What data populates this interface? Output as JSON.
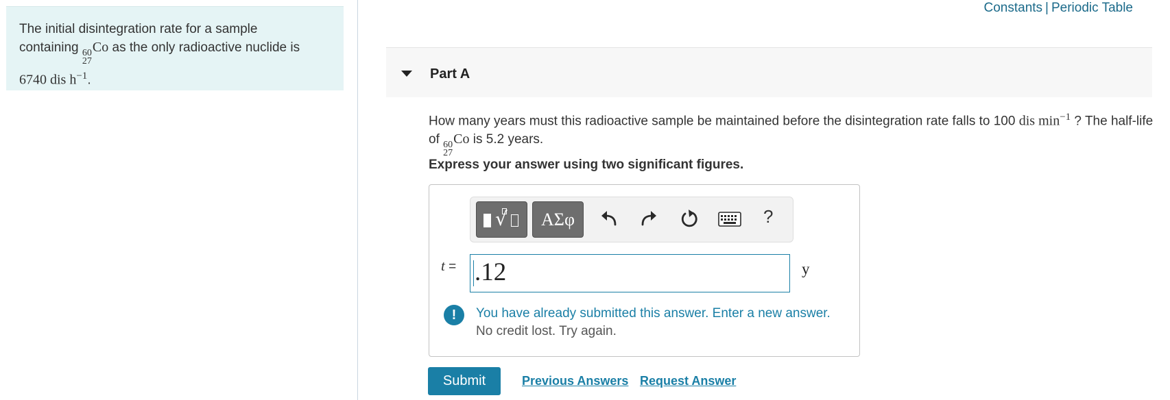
{
  "intro": {
    "line1": "The initial disintegration rate for a sample",
    "line2_pre": "containing ",
    "nuclide_mass": "60",
    "nuclide_atomic": "27",
    "nuclide_symbol": "Co",
    "line2_post": " as the only radioactive nuclide is",
    "rate_value": "6740",
    "rate_unit": " dis h",
    "rate_exp": "−1",
    "rate_end": "."
  },
  "top_links": {
    "constants": "Constants",
    "separator": "|",
    "periodic_table": "Periodic Table"
  },
  "part": {
    "title": "Part A"
  },
  "question": {
    "text_pre": "How many years must this radioactive sample be maintained before the disintegration rate falls to 100 ",
    "unit": "dis min",
    "unit_exp": "−1",
    "text_mid": " ? The half-life of ",
    "nuclide_mass": "60",
    "nuclide_atomic": "27",
    "nuclide_symbol": "Co",
    "text_post": " is 5.2 years."
  },
  "instruction": "Express your answer using two significant figures.",
  "toolbar": {
    "greek_label": "ΑΣφ",
    "help_label": "?",
    "icons": [
      "templates-icon",
      "undo-icon",
      "redo-icon",
      "reset-icon",
      "keyboard-icon",
      "help-icon"
    ]
  },
  "answer": {
    "variable": "t",
    "equals": "=",
    "value": ".12",
    "unit": "y"
  },
  "feedback": {
    "icon": "!",
    "line1": "You have already submitted this answer. Enter a new answer.",
    "line2": "No credit lost. Try again."
  },
  "actions": {
    "submit": "Submit",
    "previous_answers": "Previous Answers",
    "request_answer": "Request Answer"
  },
  "colors": {
    "accent": "#1a7fa6",
    "intro_bg": "#e5f4f5",
    "header_bg": "#f7f7f7"
  }
}
